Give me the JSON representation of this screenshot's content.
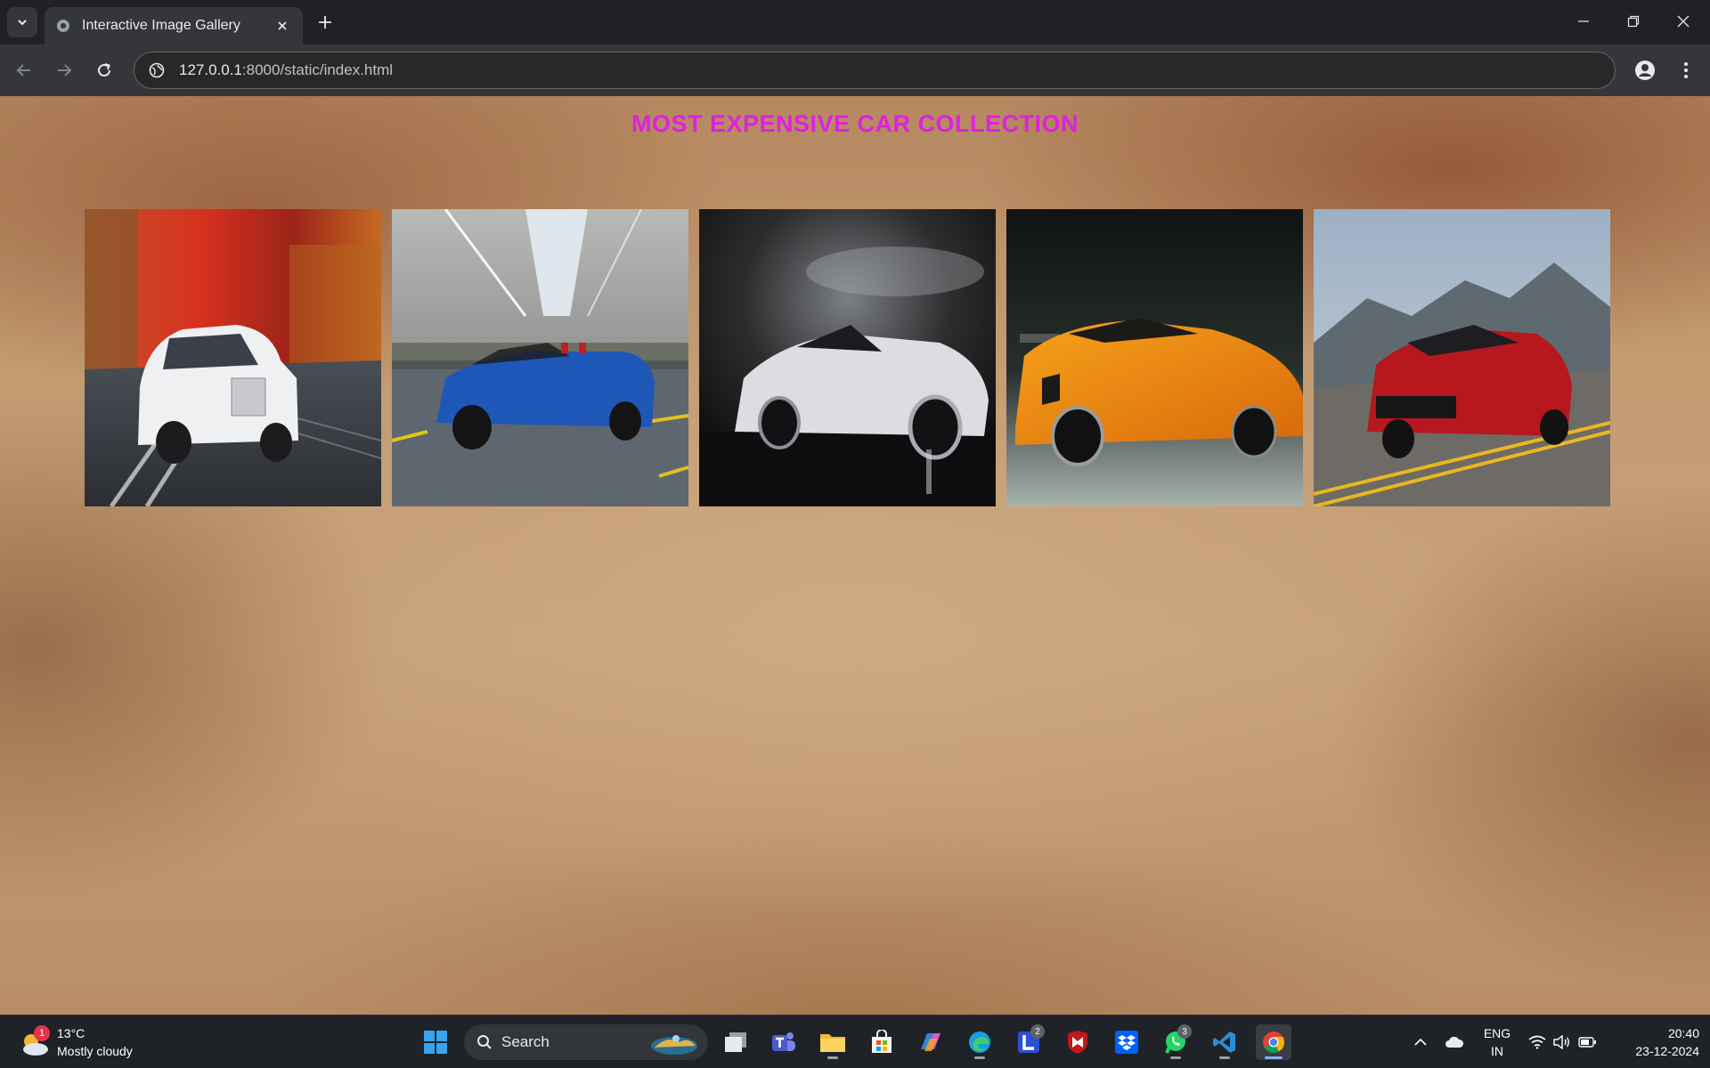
{
  "browser": {
    "tab": {
      "title": "Interactive Image Gallery"
    },
    "address": {
      "host": "127.0.0.1",
      "path": ":8000/static/index.html"
    }
  },
  "page": {
    "title": "MOST EXPENSIVE CAR COLLECTION",
    "gallery": [
      {
        "alt": "white-luxury-sedan-autumn-road"
      },
      {
        "alt": "blue-convertible-underpass"
      },
      {
        "alt": "silver-convertible-dark-studio"
      },
      {
        "alt": "orange-supercar"
      },
      {
        "alt": "red-sedan-mountain-road"
      }
    ]
  },
  "taskbar": {
    "weather": {
      "temp": "13°C",
      "condition": "Mostly cloudy",
      "badge": "1"
    },
    "search_label": "Search",
    "badges": {
      "launcher": "2",
      "whatsapp": "3"
    },
    "language": {
      "line1": "ENG",
      "line2": "IN"
    },
    "clock": {
      "time": "20:40",
      "date": "23-12-2024"
    }
  }
}
